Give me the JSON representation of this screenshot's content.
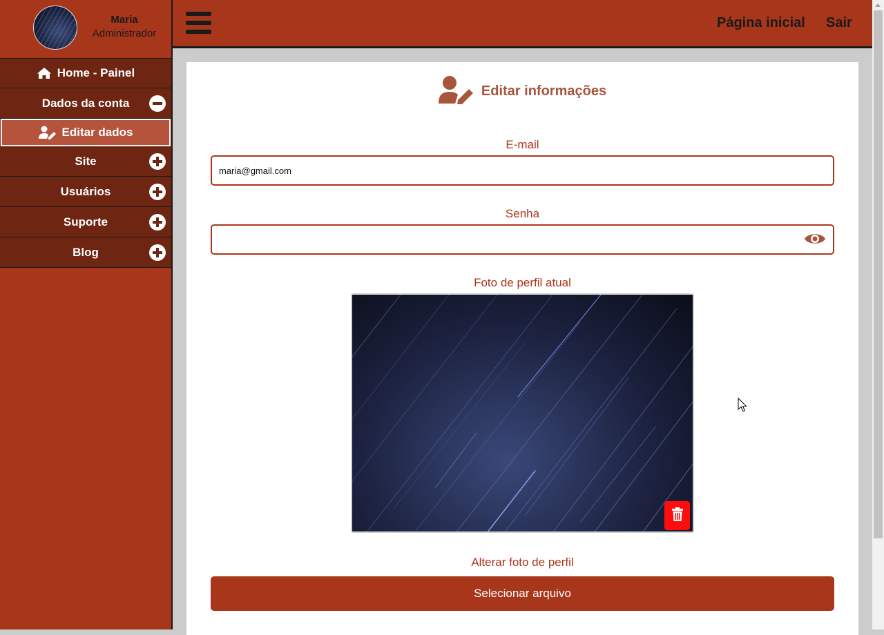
{
  "user": {
    "name": "Maria",
    "role": "Administrador"
  },
  "sidebar": {
    "items": [
      {
        "label": "Home - Painel",
        "icon": "home-icon"
      },
      {
        "label": "Dados da conta",
        "toggle": "minus-circle-icon"
      },
      {
        "label": "Editar dados",
        "icon": "user-edit-icon"
      },
      {
        "label": "Site",
        "toggle": "plus-circle-icon"
      },
      {
        "label": "Usuários",
        "toggle": "plus-circle-icon"
      },
      {
        "label": "Suporte",
        "toggle": "plus-circle-icon"
      },
      {
        "label": "Blog",
        "toggle": "plus-circle-icon"
      }
    ]
  },
  "topbar": {
    "home_link": "Página inicial",
    "logout_link": "Sair"
  },
  "form": {
    "title": "Editar informações",
    "email_label": "E-mail",
    "email_value": "maria@gmail.com",
    "password_label": "Senha",
    "password_value": "",
    "photo_label": "Foto de perfil atual",
    "change_photo_label": "Alterar foto de perfil",
    "file_button": "Selecionar arquivo"
  },
  "colors": {
    "brand": "#a8361b",
    "dark": "#6e2512",
    "active": "#b5533c",
    "danger": "#ff0d0d"
  }
}
